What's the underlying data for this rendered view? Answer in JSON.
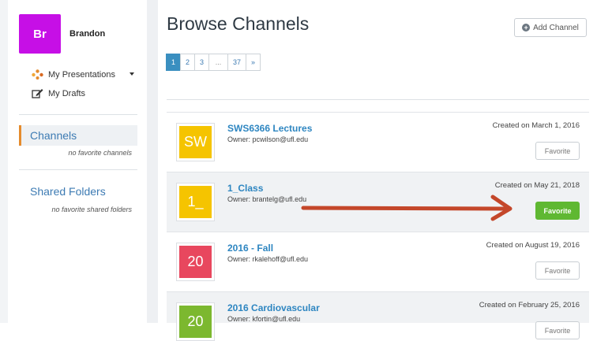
{
  "user": {
    "initials": "Br",
    "name": "Brandon"
  },
  "sidebar": {
    "menu": [
      {
        "label": "My Presentations",
        "icon": "presentations-icon"
      },
      {
        "label": "My Drafts",
        "icon": "drafts-icon"
      }
    ],
    "sections": [
      {
        "label": "Channels",
        "note": "no favorite channels",
        "active": true
      },
      {
        "label": "Shared Folders",
        "note": "no favorite shared folders",
        "active": false
      }
    ]
  },
  "main": {
    "title": "Browse Channels",
    "add_channel_label": "Add Channel",
    "pagination": [
      "1",
      "2",
      "3",
      "...",
      "37",
      "»"
    ],
    "current_page": "1"
  },
  "channels": [
    {
      "tile": "SW",
      "tile_color": "#f5c400",
      "name": "SWS6366 Lectures",
      "owner": "Owner: pcwilson@ufl.edu",
      "created": "Created on March 1, 2016",
      "favorite_label": "Favorite",
      "favorited": false
    },
    {
      "tile": "1_",
      "tile_color": "#f5c400",
      "name": "1_Class",
      "owner": "Owner: brantelg@ufl.edu",
      "created": "Created on May 21, 2018",
      "favorite_label": "Favorite",
      "favorited": true
    },
    {
      "tile": "20",
      "tile_color": "#e8475e",
      "name": "2016 - Fall",
      "owner": "Owner: rkalehoff@ufl.edu",
      "created": "Created on August 19, 2016",
      "favorite_label": "Favorite",
      "favorited": false
    },
    {
      "tile": "20",
      "tile_color": "#7cb82f",
      "name": "2016 Cardiovascular",
      "owner": "Owner: kfortin@ufl.edu",
      "created": "Created on February 25, 2016",
      "favorite_label": "Favorite",
      "favorited": false
    }
  ],
  "colors": {
    "accent": "#3a8fc0",
    "link": "#2e86c1",
    "favorite_active": "#5fb832",
    "arrow": "#c4472a",
    "active_marker": "#e58b2d"
  }
}
